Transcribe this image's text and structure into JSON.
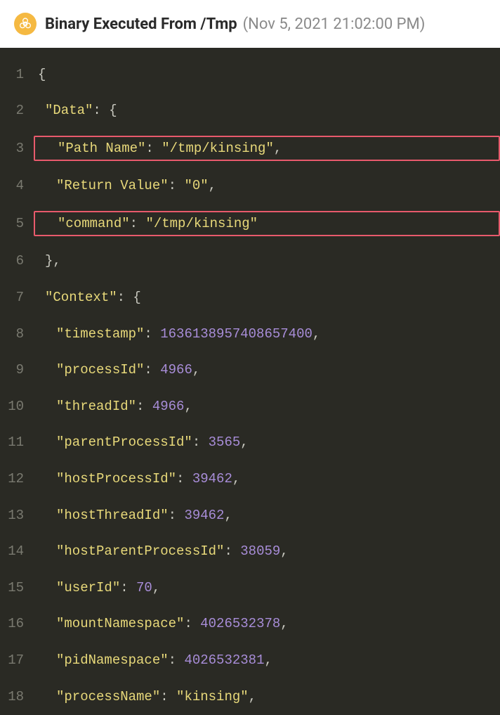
{
  "header": {
    "title": "Binary Executed From /Tmp",
    "timestamp": "(Nov 5, 2021 21:02:00 PM)"
  },
  "code": {
    "lines": [
      {
        "num": "1",
        "indent": 0,
        "highlight": false,
        "tokens": [
          {
            "t": "{",
            "c": "punct"
          }
        ]
      },
      {
        "num": "2",
        "indent": 1,
        "highlight": false,
        "tokens": [
          {
            "t": "\"Data\"",
            "c": "key"
          },
          {
            "t": ": {",
            "c": "punct"
          }
        ]
      },
      {
        "num": "3",
        "indent": 2,
        "highlight": true,
        "tokens": [
          {
            "t": "\"Path Name\"",
            "c": "key"
          },
          {
            "t": ": ",
            "c": "punct"
          },
          {
            "t": "\"/tmp/kinsing\"",
            "c": "string"
          },
          {
            "t": ",",
            "c": "punct"
          }
        ]
      },
      {
        "num": "4",
        "indent": 2,
        "highlight": false,
        "tokens": [
          {
            "t": "\"Return Value\"",
            "c": "key"
          },
          {
            "t": ": ",
            "c": "punct"
          },
          {
            "t": "\"0\"",
            "c": "string"
          },
          {
            "t": ",",
            "c": "punct"
          }
        ]
      },
      {
        "num": "5",
        "indent": 2,
        "highlight": true,
        "tokens": [
          {
            "t": "\"command\"",
            "c": "key"
          },
          {
            "t": ": ",
            "c": "punct"
          },
          {
            "t": "\"/tmp/kinsing\"",
            "c": "string"
          }
        ]
      },
      {
        "num": "6",
        "indent": 1,
        "highlight": false,
        "tokens": [
          {
            "t": "},",
            "c": "punct"
          }
        ]
      },
      {
        "num": "7",
        "indent": 1,
        "highlight": false,
        "tokens": [
          {
            "t": "\"Context\"",
            "c": "key"
          },
          {
            "t": ": {",
            "c": "punct"
          }
        ]
      },
      {
        "num": "8",
        "indent": 2,
        "highlight": false,
        "tokens": [
          {
            "t": "\"timestamp\"",
            "c": "key"
          },
          {
            "t": ": ",
            "c": "punct"
          },
          {
            "t": "1636138957408657400",
            "c": "number"
          },
          {
            "t": ",",
            "c": "punct"
          }
        ]
      },
      {
        "num": "9",
        "indent": 2,
        "highlight": false,
        "tokens": [
          {
            "t": "\"processId\"",
            "c": "key"
          },
          {
            "t": ": ",
            "c": "punct"
          },
          {
            "t": "4966",
            "c": "number"
          },
          {
            "t": ",",
            "c": "punct"
          }
        ]
      },
      {
        "num": "10",
        "indent": 2,
        "highlight": false,
        "tokens": [
          {
            "t": "\"threadId\"",
            "c": "key"
          },
          {
            "t": ": ",
            "c": "punct"
          },
          {
            "t": "4966",
            "c": "number"
          },
          {
            "t": ",",
            "c": "punct"
          }
        ]
      },
      {
        "num": "11",
        "indent": 2,
        "highlight": false,
        "tokens": [
          {
            "t": "\"parentProcessId\"",
            "c": "key"
          },
          {
            "t": ": ",
            "c": "punct"
          },
          {
            "t": "3565",
            "c": "number"
          },
          {
            "t": ",",
            "c": "punct"
          }
        ]
      },
      {
        "num": "12",
        "indent": 2,
        "highlight": false,
        "tokens": [
          {
            "t": "\"hostProcessId\"",
            "c": "key"
          },
          {
            "t": ": ",
            "c": "punct"
          },
          {
            "t": "39462",
            "c": "number"
          },
          {
            "t": ",",
            "c": "punct"
          }
        ]
      },
      {
        "num": "13",
        "indent": 2,
        "highlight": false,
        "tokens": [
          {
            "t": "\"hostThreadId\"",
            "c": "key"
          },
          {
            "t": ": ",
            "c": "punct"
          },
          {
            "t": "39462",
            "c": "number"
          },
          {
            "t": ",",
            "c": "punct"
          }
        ]
      },
      {
        "num": "14",
        "indent": 2,
        "highlight": false,
        "tokens": [
          {
            "t": "\"hostParentProcessId\"",
            "c": "key"
          },
          {
            "t": ": ",
            "c": "punct"
          },
          {
            "t": "38059",
            "c": "number"
          },
          {
            "t": ",",
            "c": "punct"
          }
        ]
      },
      {
        "num": "15",
        "indent": 2,
        "highlight": false,
        "tokens": [
          {
            "t": "\"userId\"",
            "c": "key"
          },
          {
            "t": ": ",
            "c": "punct"
          },
          {
            "t": "70",
            "c": "number"
          },
          {
            "t": ",",
            "c": "punct"
          }
        ]
      },
      {
        "num": "16",
        "indent": 2,
        "highlight": false,
        "tokens": [
          {
            "t": "\"mountNamespace\"",
            "c": "key"
          },
          {
            "t": ": ",
            "c": "punct"
          },
          {
            "t": "4026532378",
            "c": "number"
          },
          {
            "t": ",",
            "c": "punct"
          }
        ]
      },
      {
        "num": "17",
        "indent": 2,
        "highlight": false,
        "tokens": [
          {
            "t": "\"pidNamespace\"",
            "c": "key"
          },
          {
            "t": ": ",
            "c": "punct"
          },
          {
            "t": "4026532381",
            "c": "number"
          },
          {
            "t": ",",
            "c": "punct"
          }
        ]
      },
      {
        "num": "18",
        "indent": 2,
        "highlight": false,
        "tokens": [
          {
            "t": "\"processName\"",
            "c": "key"
          },
          {
            "t": ": ",
            "c": "punct"
          },
          {
            "t": "\"kinsing\"",
            "c": "string"
          },
          {
            "t": ",",
            "c": "punct"
          }
        ]
      }
    ]
  }
}
